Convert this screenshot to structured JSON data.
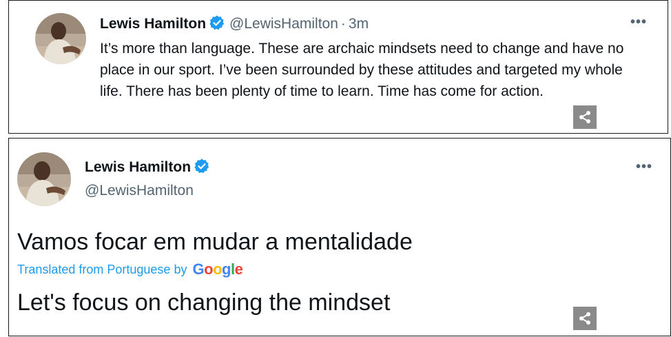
{
  "tweet1": {
    "display_name": "Lewis Hamilton",
    "handle": "@LewisHamilton",
    "separator": "·",
    "time": "3m",
    "more": "•••",
    "text": "It’s more than language. These are archaic mindsets need to change and have no place in our sport. I’ve been surrounded by these attitudes and targeted my whole life. There has been plenty of time to learn. Time has come for action.",
    "verified_icon": "verified-badge-icon",
    "share_icon": "share-icon"
  },
  "tweet2": {
    "display_name": "Lewis Hamilton",
    "handle": "@LewisHamilton",
    "more": "•••",
    "original_text": "Vamos focar em mudar a mentalidade",
    "translated_label": "Translated from Portuguese by",
    "google_logo_text": "Google",
    "translated_text": "Let's focus on changing the mindset",
    "verified_icon": "verified-badge-icon",
    "share_icon": "share-icon"
  },
  "colors": {
    "verified": "#1d9bf0",
    "link": "#1d9bf0",
    "secondary_text": "#536471",
    "primary_text": "#0f1419",
    "share_bg": "#8a8a8a"
  }
}
